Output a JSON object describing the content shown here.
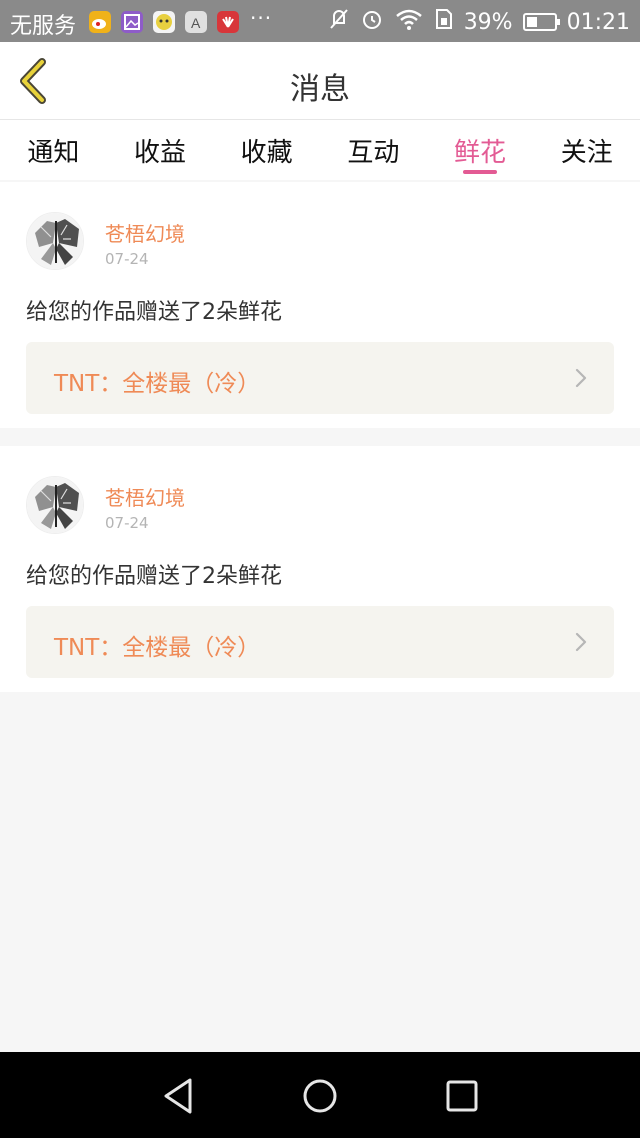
{
  "status_bar": {
    "carrier": "无服务",
    "battery_percent": "39%",
    "time": "01:21",
    "battery_level": 0.39,
    "notification_icons": [
      "weibo-icon",
      "gallery-icon",
      "chat-app-icon",
      "font-app-icon",
      "huawei-app-icon"
    ],
    "more_indicator": "···"
  },
  "header": {
    "back_icon": "chevron-left-icon",
    "title": "消息"
  },
  "tabs": [
    {
      "label": "通知",
      "active": false
    },
    {
      "label": "收益",
      "active": false
    },
    {
      "label": "收藏",
      "active": false
    },
    {
      "label": "互动",
      "active": false
    },
    {
      "label": "鲜花",
      "active": true
    },
    {
      "label": "关注",
      "active": false
    }
  ],
  "messages": [
    {
      "user_name": "苍梧幻境",
      "date": "07-24",
      "text": "给您的作品赠送了2朵鲜花",
      "work_title": "TNT：全楼最（冷）"
    },
    {
      "user_name": "苍梧幻境",
      "date": "07-24",
      "text": "给您的作品赠送了2朵鲜花",
      "work_title": "TNT：全楼最（冷）"
    }
  ],
  "colors": {
    "accent_pink": "#e35b94",
    "accent_orange": "#ef8a56",
    "back_arrow_yellow": "#e8d23a"
  },
  "nav_bar": {
    "icons": [
      "back-triangle-icon",
      "home-circle-icon",
      "recents-square-icon"
    ]
  }
}
